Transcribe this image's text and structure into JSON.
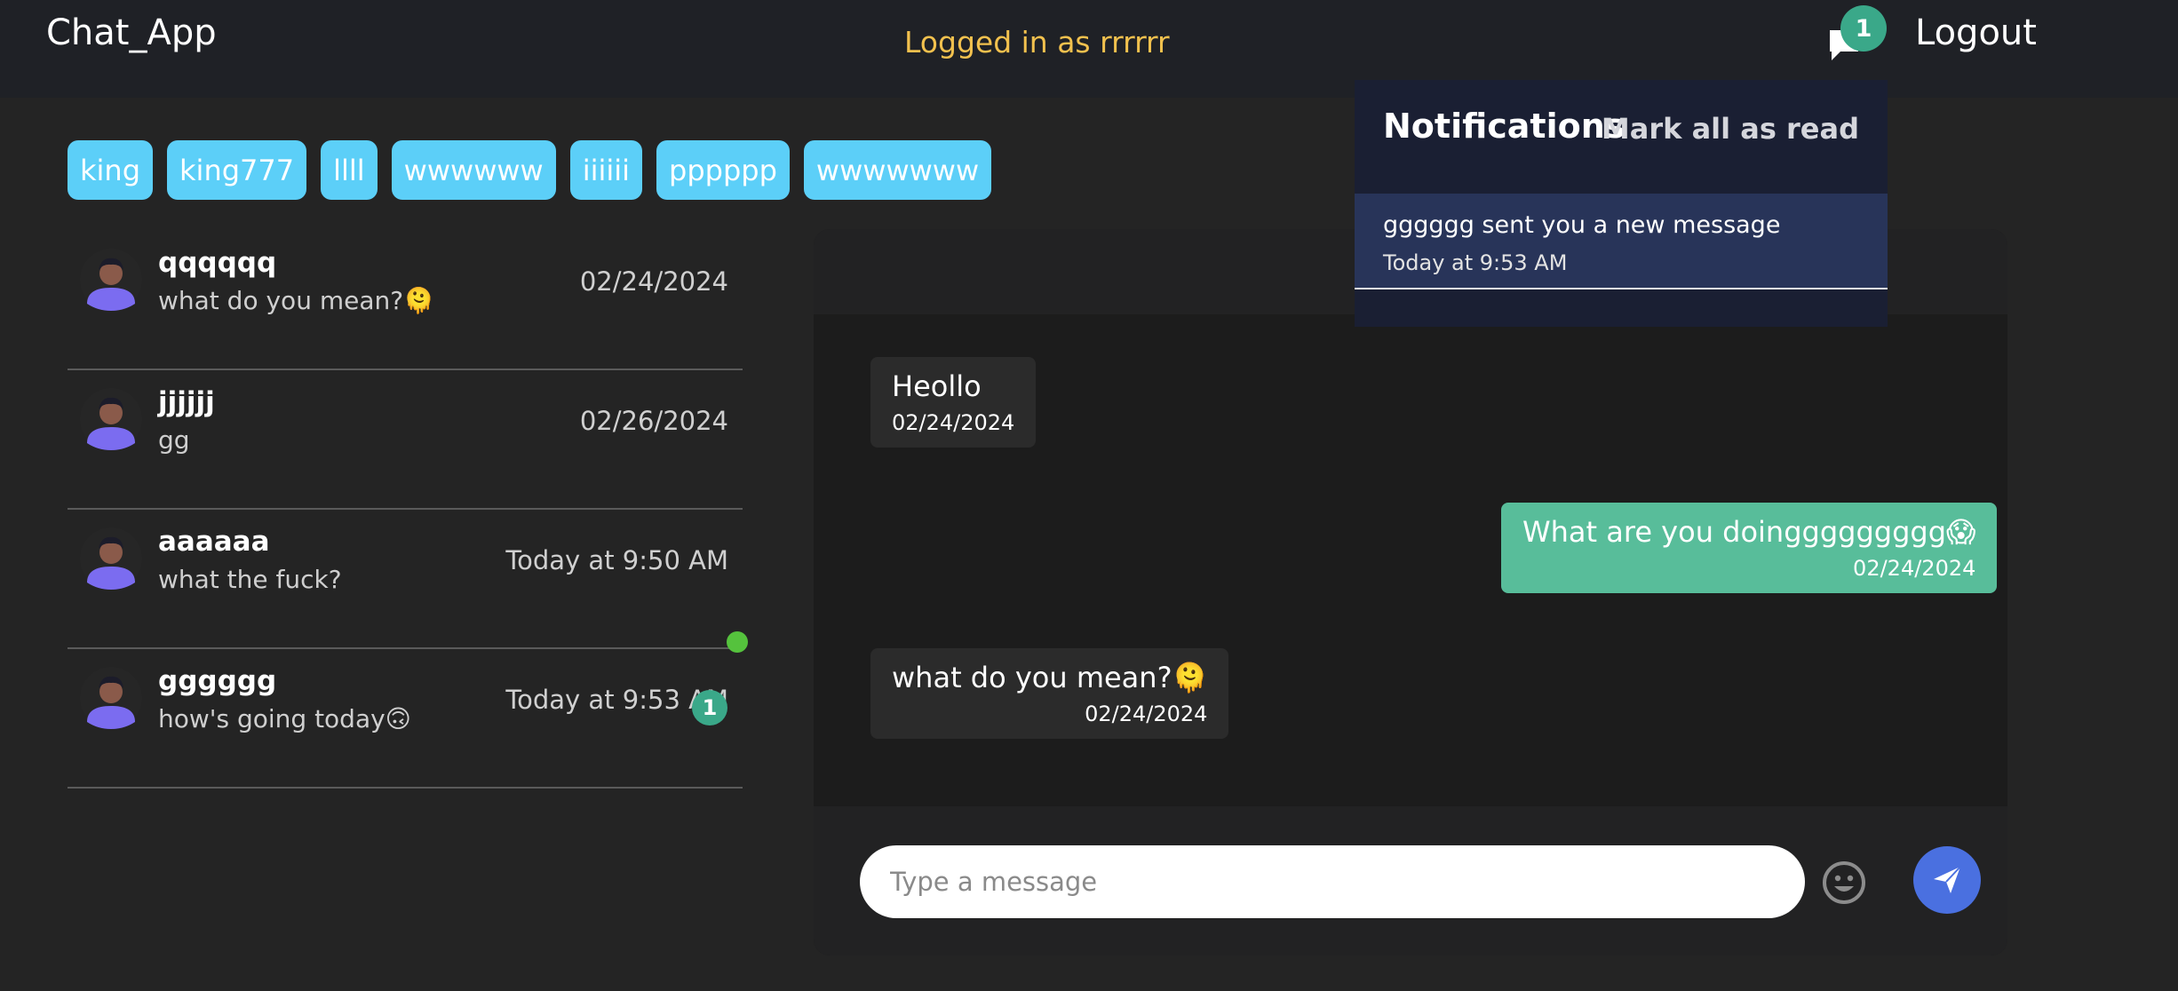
{
  "navbar": {
    "brand": "Chat_App",
    "logged_in": "Logged in as rrrrrr",
    "notification_count": "1",
    "logout": "Logout"
  },
  "users": [
    "king",
    "king777",
    "llll",
    "wwwwww",
    "iiiiii",
    "pppppp",
    "wwwwwww"
  ],
  "chats": [
    {
      "name": "qqqqqq",
      "last_message": "what do you mean?🫠",
      "date": "02/24/2024"
    },
    {
      "name": "jjjjjj",
      "last_message": "gg",
      "date": "02/26/2024"
    },
    {
      "name": "aaaaaa",
      "last_message": "what the fuck?",
      "date": "Today at 9:50 AM"
    },
    {
      "name": "gggggg",
      "last_message": "how's going today🙃",
      "date": "Today at 9:53 AM",
      "unread": "1",
      "online": true
    }
  ],
  "messages": [
    {
      "text": "Heollo",
      "date": "02/24/2024",
      "sender": "them"
    },
    {
      "text": "What are you doinggggggggg😱",
      "date": "02/24/2024",
      "sender": "me"
    },
    {
      "text": "what do you mean?🫠",
      "date": "02/24/2024",
      "sender": "them"
    }
  ],
  "composer": {
    "placeholder": "Type a message"
  },
  "notifications": {
    "title": "Notifications",
    "mark_all": "Mark all as read",
    "items": [
      {
        "text": "gggggg sent you a new message",
        "time": "Today at 9:53 AM"
      }
    ]
  },
  "colors": {
    "accent": "#5ccff8",
    "sent_bubble": "#58bd9a",
    "badge": "#3aa889",
    "online": "#55c23d",
    "send_button": "#4a70e0",
    "logged_in_text": "#f2c14e"
  },
  "icons": {
    "notification": "chat-bubble-icon",
    "avatar": "user-avatar-icon",
    "emoji": "smiley-icon",
    "send": "paper-plane-icon"
  }
}
